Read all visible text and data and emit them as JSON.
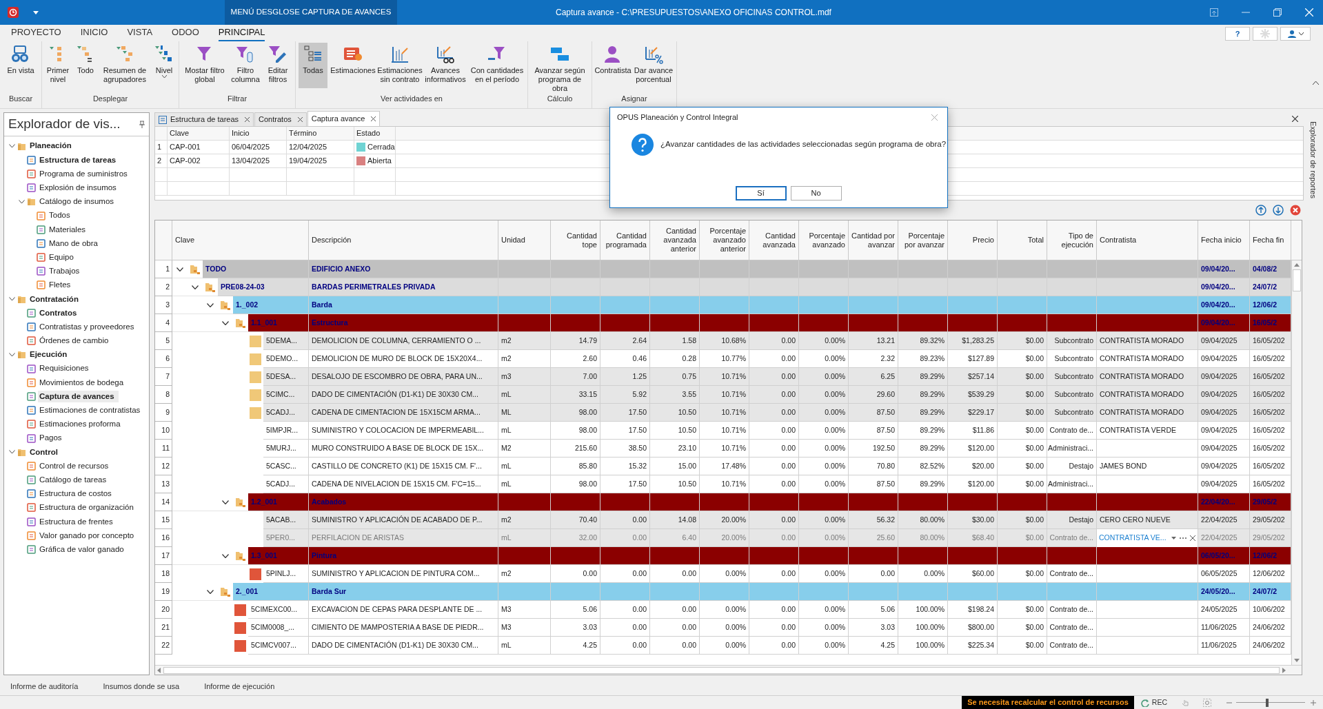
{
  "window": {
    "title": "Captura avance - C:\\PRESUPUESTOS\\ANEXO OFICINAS CONTROL.mdf",
    "context_menu": "MENÚ DESGLOSE CAPTURA DE AVANCES"
  },
  "menu_tabs": [
    {
      "label": "PROYECTO",
      "selected": false
    },
    {
      "label": "INICIO",
      "selected": false
    },
    {
      "label": "VISTA",
      "selected": false
    },
    {
      "label": "ODOO",
      "selected": false
    },
    {
      "label": "PRINCIPAL",
      "selected": true
    }
  ],
  "help_button": "?",
  "ribbon": [
    {
      "label": "Buscar",
      "buttons": [
        {
          "label": "En vista",
          "selected": false
        }
      ]
    },
    {
      "label": "Desplegar",
      "buttons": [
        {
          "label": "Primer nivel",
          "selected": false
        },
        {
          "label": "Todo",
          "selected": false
        },
        {
          "label": "Resumen de agrupadores",
          "selected": false
        },
        {
          "label": "Nivel",
          "selected": false,
          "dropdown": true
        }
      ]
    },
    {
      "label": "Filtrar",
      "buttons": [
        {
          "label": "Mostar filtro global",
          "selected": false
        },
        {
          "label": "Filtro columna",
          "selected": false
        },
        {
          "label": "Editar filtros",
          "selected": false
        }
      ]
    },
    {
      "label": "Ver actividades en",
      "buttons": [
        {
          "label": "Todas",
          "selected": true
        },
        {
          "label": "Estimaciones",
          "selected": false
        },
        {
          "label": "Estimaciones sin contrato",
          "selected": false
        },
        {
          "label": "Avances informativos",
          "selected": false
        },
        {
          "label": "Con cantidades en el período",
          "selected": false
        }
      ]
    },
    {
      "label": "Cálculo",
      "buttons": [
        {
          "label": "Avanzar según programa de obra",
          "selected": false
        }
      ]
    },
    {
      "label": "Asignar",
      "buttons": [
        {
          "label": "Contratista",
          "selected": false
        },
        {
          "label": "Dar avance porcentual",
          "selected": false
        }
      ]
    }
  ],
  "sidebar": {
    "title": "Explorador de vis...",
    "items": [
      {
        "label": "Planeación",
        "kind": "folder",
        "expanded": true,
        "children": [
          {
            "label": "Estructura de tareas",
            "open": true,
            "selected": false
          },
          {
            "label": "Programa de suministros",
            "open": false,
            "selected": false
          },
          {
            "label": "Explosión de insumos",
            "open": false,
            "selected": false
          },
          {
            "label": "Catálogo de insumos",
            "kind": "folder",
            "expanded": true,
            "children": [
              {
                "label": "Todos",
                "open": false,
                "selected": false
              },
              {
                "label": "Materiales",
                "open": false,
                "selected": false
              },
              {
                "label": "Mano de obra",
                "open": false,
                "selected": false
              },
              {
                "label": "Equipo",
                "open": false,
                "selected": false
              },
              {
                "label": "Trabajos",
                "open": false,
                "selected": false
              },
              {
                "label": "Fletes",
                "open": false,
                "selected": false
              }
            ]
          }
        ]
      },
      {
        "label": "Contratación",
        "kind": "folder",
        "expanded": true,
        "children": [
          {
            "label": "Contratos",
            "open": true,
            "selected": false
          },
          {
            "label": "Contratistas y proveedores",
            "open": false,
            "selected": false
          },
          {
            "label": "Órdenes de cambio",
            "open": false,
            "selected": false
          }
        ]
      },
      {
        "label": "Ejecución",
        "kind": "folder",
        "expanded": true,
        "children": [
          {
            "label": "Requisiciones",
            "open": false,
            "selected": false
          },
          {
            "label": "Movimientos de bodega",
            "open": false,
            "selected": false
          },
          {
            "label": "Captura de avances",
            "open": true,
            "selected": true
          },
          {
            "label": "Estimaciones de contratistas",
            "open": false,
            "selected": false
          },
          {
            "label": "Estimaciones proforma",
            "open": false,
            "selected": false
          },
          {
            "label": "Pagos",
            "open": false,
            "selected": false
          }
        ]
      },
      {
        "label": "Control",
        "kind": "folder",
        "expanded": true,
        "children": [
          {
            "label": "Control de recursos",
            "open": false,
            "selected": false
          },
          {
            "label": "Catálogo de tareas",
            "open": false,
            "selected": false
          },
          {
            "label": "Estructura de costos",
            "open": false,
            "selected": false
          },
          {
            "label": "Estructura de organización",
            "open": false,
            "selected": false
          },
          {
            "label": "Estructura de frentes",
            "open": false,
            "selected": false
          },
          {
            "label": "Valor ganado por concepto",
            "open": false,
            "selected": false
          },
          {
            "label": "Gráfica de valor ganado",
            "open": false,
            "selected": false
          }
        ]
      }
    ]
  },
  "document_tabs": [
    {
      "label": "Estructura de tareas",
      "selected": false
    },
    {
      "label": "Contratos",
      "selected": false
    },
    {
      "label": "Captura avance",
      "selected": true
    }
  ],
  "periods": {
    "columns": [
      "Clave",
      "Inicio",
      "Término",
      "Estado"
    ],
    "rows": [
      {
        "num": "1",
        "clave": "CAP-001",
        "inicio": "06/04/2025",
        "termino": "12/04/2025",
        "estado": "Cerrada",
        "color": "#6fd3d3"
      },
      {
        "num": "2",
        "clave": "CAP-002",
        "inicio": "13/04/2025",
        "termino": "19/04/2025",
        "estado": "Abierta",
        "color": "#d98080"
      }
    ]
  },
  "grid": {
    "columns": [
      "Clave",
      "Descripción",
      "Unidad",
      "Cantidad tope",
      "Cantidad programada",
      "Cantidad avanzada anterior",
      "Porcentaje avanzado anterior",
      "Cantidad avanzada",
      "Porcentaje avanzado",
      "Cantidad por avanzar",
      "Porcentaje por avanzar",
      "Precio",
      "Total",
      "Tipo de ejecución",
      "Contratista",
      "Fecha inicio",
      "Fecha fin"
    ],
    "rows": [
      {
        "num": "1",
        "kind": "group",
        "clave": "TODO",
        "descripcion": "EDIFICIO ANEXO",
        "fecha_inicio": "09/04/20...",
        "fecha_fin": "04/08/2",
        "expanded": true,
        "children": [
          {
            "num": "2",
            "kind": "group",
            "clave": "PRE08-24-03",
            "descripcion": "BARDAS PERIMETRALES PRIVADA",
            "fecha_inicio": "09/04/20...",
            "fecha_fin": "24/07/2",
            "expanded": true,
            "children": [
              {
                "num": "3",
                "kind": "group",
                "clave": "1._002",
                "descripcion": "Barda",
                "fecha_inicio": "09/04/20...",
                "fecha_fin": "12/06/2",
                "expanded": true,
                "children": [
                  {
                    "num": "4",
                    "kind": "group",
                    "clave": "1.1_001",
                    "descripcion": "Estructura",
                    "fecha_inicio": "09/04/20...",
                    "fecha_fin": "16/05/2",
                    "expanded": true,
                    "children": [
                      {
                        "num": "5",
                        "kind": "activity",
                        "selected": true,
                        "editing": false,
                        "color": "#f0c878",
                        "cells": [
                          "5DEMA...",
                          "DEMOLICION DE COLUMNA, CERRAMIENTO O ...",
                          "m2",
                          "14.79",
                          "2.64",
                          "1.58",
                          "10.68%",
                          "0.00",
                          "0.00%",
                          "13.21",
                          "89.32%",
                          "$1,283.25",
                          "$0.00",
                          "Subcontrato",
                          "CONTRATISTA MORADO",
                          "09/04/2025",
                          "16/05/202"
                        ]
                      },
                      {
                        "num": "6",
                        "kind": "activity",
                        "selected": false,
                        "editing": false,
                        "color": "#f0c878",
                        "cells": [
                          "5DEMO...",
                          "DEMOLICION DE MURO DE BLOCK DE 15X20X4...",
                          "m2",
                          "2.60",
                          "0.46",
                          "0.28",
                          "10.77%",
                          "0.00",
                          "0.00%",
                          "2.32",
                          "89.23%",
                          "$127.89",
                          "$0.00",
                          "Subcontrato",
                          "CONTRATISTA MORADO",
                          "09/04/2025",
                          "16/05/202"
                        ]
                      },
                      {
                        "num": "7",
                        "kind": "activity",
                        "selected": true,
                        "editing": false,
                        "color": "#f0c878",
                        "cells": [
                          "5DESA...",
                          "DESALOJO DE ESCOMBRO DE OBRA, PARA UN...",
                          "m3",
                          "7.00",
                          "1.25",
                          "0.75",
                          "10.71%",
                          "0.00",
                          "0.00%",
                          "6.25",
                          "89.29%",
                          "$257.14",
                          "$0.00",
                          "Subcontrato",
                          "CONTRATISTA MORADO",
                          "09/04/2025",
                          "16/05/202"
                        ]
                      },
                      {
                        "num": "8",
                        "kind": "activity",
                        "selected": true,
                        "editing": false,
                        "color": "#f0c878",
                        "cells": [
                          "5CIMC...",
                          "DADO DE CIMENTACIÓN (D1-K1) DE 30X30 CM...",
                          "mL",
                          "33.15",
                          "5.92",
                          "3.55",
                          "10.71%",
                          "0.00",
                          "0.00%",
                          "29.60",
                          "89.29%",
                          "$539.29",
                          "$0.00",
                          "Subcontrato",
                          "CONTRATISTA MORADO",
                          "09/04/2025",
                          "16/05/202"
                        ]
                      },
                      {
                        "num": "9",
                        "kind": "activity",
                        "selected": true,
                        "editing": false,
                        "color": "#f0c878",
                        "cells": [
                          "5CADJ...",
                          "CADENA DE CIMENTACION DE 15X15CM ARMA...",
                          "ML",
                          "98.00",
                          "17.50",
                          "10.50",
                          "10.71%",
                          "0.00",
                          "0.00%",
                          "87.50",
                          "89.29%",
                          "$229.17",
                          "$0.00",
                          "Subcontrato",
                          "CONTRATISTA MORADO",
                          "09/04/2025",
                          "16/05/202"
                        ]
                      },
                      {
                        "num": "10",
                        "kind": "activity",
                        "selected": false,
                        "editing": false,
                        "cells": [
                          "5IMPJR...",
                          "SUMINISTRO Y COLOCACION DE IMPERMEABIL...",
                          "mL",
                          "98.00",
                          "17.50",
                          "10.50",
                          "10.71%",
                          "0.00",
                          "0.00%",
                          "87.50",
                          "89.29%",
                          "$11.86",
                          "$0.00",
                          "Contrato de...",
                          "CONTRATISTA VERDE",
                          "09/04/2025",
                          "16/05/202"
                        ]
                      },
                      {
                        "num": "11",
                        "kind": "activity",
                        "selected": false,
                        "editing": false,
                        "cells": [
                          "5MURJ...",
                          "MURO CONSTRUIDO A BASE DE BLOCK DE 15X...",
                          "M2",
                          "215.60",
                          "38.50",
                          "23.10",
                          "10.71%",
                          "0.00",
                          "0.00%",
                          "192.50",
                          "89.29%",
                          "$120.00",
                          "$0.00",
                          "Administraci...",
                          null,
                          "09/04/2025",
                          "16/05/202"
                        ]
                      },
                      {
                        "num": "12",
                        "kind": "activity",
                        "selected": false,
                        "editing": false,
                        "cells": [
                          "5CASC...",
                          "CASTILLO DE CONCRETO (K1) DE 15X15 CM. F'...",
                          "mL",
                          "85.80",
                          "15.32",
                          "15.00",
                          "17.48%",
                          "0.00",
                          "0.00%",
                          "70.80",
                          "82.52%",
                          "$20.00",
                          "$0.00",
                          "Destajo",
                          "JAMES BOND",
                          "09/04/2025",
                          "16/05/202"
                        ]
                      },
                      {
                        "num": "13",
                        "kind": "activity",
                        "selected": false,
                        "editing": false,
                        "cells": [
                          "5CADJ...",
                          "CADENA DE NIVELACION DE 15X15 CM. F'C=15...",
                          "mL",
                          "98.00",
                          "17.50",
                          "10.50",
                          "10.71%",
                          "0.00",
                          "0.00%",
                          "87.50",
                          "89.29%",
                          "$120.00",
                          "$0.00",
                          "Administraci...",
                          null,
                          "09/04/2025",
                          "16/05/202"
                        ]
                      }
                    ]
                  },
                  {
                    "num": "14",
                    "kind": "group",
                    "clave": "1.2_001",
                    "descripcion": "Acabados",
                    "fecha_inicio": "22/04/20...",
                    "fecha_fin": "29/05/2",
                    "expanded": true,
                    "children": [
                      {
                        "num": "15",
                        "kind": "activity",
                        "selected": true,
                        "editing": false,
                        "cells": [
                          "5ACAB...",
                          "SUMINISTRO Y APLICACIÓN DE ACABADO DE P...",
                          "m2",
                          "70.40",
                          "0.00",
                          "14.08",
                          "20.00%",
                          "0.00",
                          "0.00%",
                          "56.32",
                          "80.00%",
                          "$30.00",
                          "$0.00",
                          "Destajo",
                          "CERO CERO NUEVE",
                          "22/04/2025",
                          "29/05/202"
                        ]
                      },
                      {
                        "num": "16",
                        "kind": "activity",
                        "selected": true,
                        "editing": true,
                        "cells": [
                          "5PER0...",
                          "PERFILACION DE ARISTAS",
                          "mL",
                          "32.00",
                          "0.00",
                          "6.40",
                          "20.00%",
                          "0.00",
                          "0.00%",
                          "25.60",
                          "80.00%",
                          "$68.40",
                          "$0.00",
                          "Contrato de...",
                          "CONTRATISTA VE...",
                          "22/04/2025",
                          "29/05/202"
                        ]
                      }
                    ]
                  },
                  {
                    "num": "17",
                    "kind": "group",
                    "clave": "1.3_001",
                    "descripcion": "Pintura",
                    "fecha_inicio": "06/05/20...",
                    "fecha_fin": "12/06/2",
                    "expanded": true,
                    "children": [
                      {
                        "num": "18",
                        "kind": "activity",
                        "selected": false,
                        "editing": false,
                        "color": "#e0553a",
                        "cells": [
                          "5PINLJ...",
                          "SUMINISTRO Y APLICACION DE PINTURA COM...",
                          "m2",
                          "0.00",
                          "0.00",
                          "0.00",
                          "0.00%",
                          "0.00",
                          "0.00%",
                          "0.00",
                          "0.00%",
                          "$60.00",
                          "$0.00",
                          "Contrato de...",
                          null,
                          "06/05/2025",
                          "12/06/202"
                        ]
                      }
                    ]
                  }
                ]
              },
              {
                "num": "19",
                "kind": "group",
                "clave": "2._001",
                "descripcion": "Barda Sur",
                "fecha_inicio": "24/05/20...",
                "fecha_fin": "24/07/2",
                "expanded": true,
                "children": [
                  {
                    "num": "20",
                    "kind": "activity",
                    "selected": false,
                    "editing": false,
                    "color": "#e0553a",
                    "cells": [
                      "5CIMEXC00...",
                      "EXCAVACION DE CEPAS PARA DESPLANTE DE ...",
                      "M3",
                      "5.06",
                      "0.00",
                      "0.00",
                      "0.00%",
                      "0.00",
                      "0.00%",
                      "5.06",
                      "100.00%",
                      "$198.24",
                      "$0.00",
                      "Contrato de...",
                      null,
                      "24/05/2025",
                      "10/06/202"
                    ]
                  },
                  {
                    "num": "21",
                    "kind": "activity",
                    "selected": false,
                    "editing": false,
                    "color": "#e0553a",
                    "cells": [
                      "5CIM0008_...",
                      "CIMIENTO DE MAMPOSTERIA A BASE DE PIEDR...",
                      "M3",
                      "3.03",
                      "0.00",
                      "0.00",
                      "0.00%",
                      "0.00",
                      "0.00%",
                      "3.03",
                      "100.00%",
                      "$800.00",
                      "$0.00",
                      "Contrato de...",
                      null,
                      "11/06/2025",
                      "24/06/202"
                    ]
                  },
                  {
                    "num": "22",
                    "kind": "activity",
                    "selected": false,
                    "editing": false,
                    "color": "#e0553a",
                    "cells": [
                      "5CIMCV007...",
                      "DADO DE CIMENTACIÓN (D1-K1) DE 30X30 CM...",
                      "mL",
                      "4.25",
                      "0.00",
                      "0.00",
                      "0.00%",
                      "0.00",
                      "0.00%",
                      "4.25",
                      "100.00%",
                      "$225.34",
                      "$0.00",
                      "Contrato de...",
                      null,
                      "11/06/2025",
                      "24/06/202"
                    ]
                  }
                ]
              }
            ]
          }
        ]
      }
    ]
  },
  "dialog": {
    "title": "OPUS Planeación y Control Integral",
    "message": "¿Avanzar cantidades de las actividades seleccionadas según programa de obra?",
    "buttons": [
      {
        "label": "Sí",
        "focused": true
      },
      {
        "label": "No",
        "focused": false
      }
    ]
  },
  "right_panel": "Explorador de reportes",
  "bottom_tabs": [
    "Informe de auditoría",
    "Insumos donde se usa",
    "Informe de ejecución"
  ],
  "status_bar": {
    "warning": "Se necesita recalcular el control de recursos",
    "rec": "REC",
    "zoom": {
      "level": 0.45
    }
  }
}
